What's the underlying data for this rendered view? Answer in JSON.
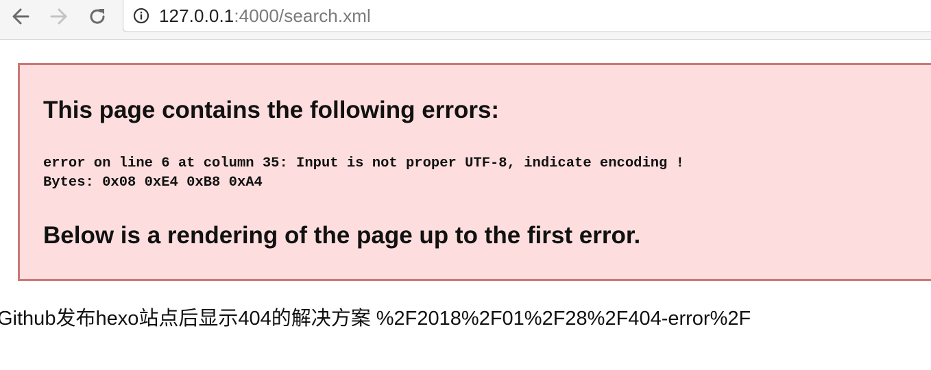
{
  "browser": {
    "url_host": "127.0.0.1",
    "url_path": ":4000/search.xml",
    "icons": {
      "back": "arrow-left-icon",
      "forward": "arrow-right-icon",
      "reload": "reload-icon",
      "site_info": "info-circle-icon"
    }
  },
  "error": {
    "heading": "This page contains the following errors:",
    "detail_line1": "error on line 6 at column 35: Input is not proper UTF-8, indicate encoding !",
    "detail_line2": "Bytes: 0x08 0xE4 0xB8 0xA4",
    "footer": "Below is a rendering of the page up to the first error."
  },
  "rendered": {
    "text": "Github发布hexo站点后显示404的解决方案 %2F2018%2F01%2F28%2F404-error%2F"
  },
  "colors": {
    "error_background": "#fddddd",
    "error_border": "#cc7777",
    "toolbar_background": "#f5f5f5",
    "url_path": "#7a7a7a"
  }
}
